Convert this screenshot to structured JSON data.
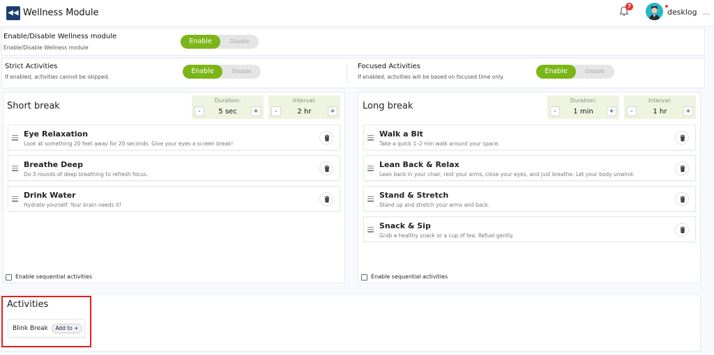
{
  "header": {
    "title": "Wellness Module",
    "back_icon": "double-chevron-left-icon",
    "notification_count": "7",
    "user_name": "desklog",
    "user_caret": "..."
  },
  "module_toggle": {
    "title": "Enable/Disable Wellness module",
    "subtitle": "Enable/Disable Wellness module",
    "on_label": "Enable",
    "off_label": "Disable"
  },
  "strict": {
    "title": "Strict Activities",
    "subtitle": "If enabled, activities cannot be skipped.",
    "on_label": "Enable",
    "off_label": "Disable"
  },
  "focused": {
    "title": "Focused Activities",
    "subtitle": "If enabled, activities will be based on focused time only.",
    "on_label": "Enable",
    "off_label": "Disable"
  },
  "short_break": {
    "title": "Short break",
    "duration_label": "Duration:",
    "duration_value": "5 sec",
    "interval_label": "Interval:",
    "interval_value": "2 hr",
    "minus": "-",
    "plus": "+",
    "activities": [
      {
        "title": "Eye Relaxation",
        "desc": "Look at something 20 feet away for 20 seconds. Give your eyes a screen break!"
      },
      {
        "title": "Breathe Deep",
        "desc": "Do 3 rounds of deep breathing to refresh focus."
      },
      {
        "title": "Drink Water",
        "desc": "Hydrate yourself. Your brain needs it!"
      }
    ],
    "sequential_label": "Enable sequential activities"
  },
  "long_break": {
    "title": "Long break",
    "duration_label": "Duration:",
    "duration_value": "1 min",
    "interval_label": "Interval:",
    "interval_value": "1 hr",
    "minus": "-",
    "plus": "+",
    "activities": [
      {
        "title": "Walk a Bit",
        "desc": "Take a quick 1–2 min walk around your space."
      },
      {
        "title": "Lean Back & Relax",
        "desc": "Lean back in your chair, rest your arms, close your eyes, and just breathe. Let your body unwind."
      },
      {
        "title": "Stand & Stretch",
        "desc": "Stand up and stretch your arms and back."
      },
      {
        "title": "Snack & Sip",
        "desc": "Grab a healthy snack or a cup of tea. Refuel gently."
      }
    ],
    "sequential_label": "Enable sequential activities"
  },
  "activities_section": {
    "title": "Activities",
    "items": [
      {
        "name": "Blink Break",
        "add_label": "Add to +"
      }
    ]
  },
  "colors": {
    "accent_green": "#7cb518",
    "header_button": "#1f3d6e",
    "badge_red": "#e53935",
    "highlight_red": "#e02020"
  }
}
